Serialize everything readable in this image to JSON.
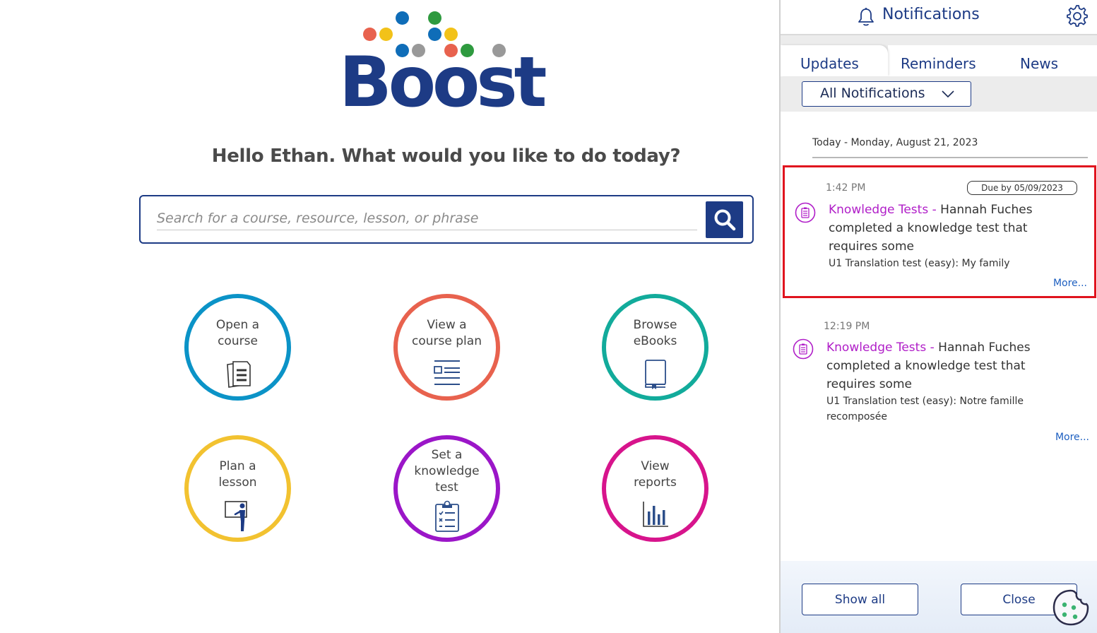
{
  "app": {
    "logo_text": "Boost",
    "logo_dot_colors": [
      "#e8624e",
      "#f2c219",
      "#0f6db8",
      "#2e9a3f",
      "#999999"
    ]
  },
  "main": {
    "greeting": "Hello Ethan. What would you like to do today?",
    "search": {
      "placeholder": "Search for a course, resource, lesson, or phrase",
      "value": ""
    },
    "tiles": [
      {
        "label": "Open a\ncourse",
        "color": "#0b93c7",
        "icon": "documents-icon"
      },
      {
        "label": "View a\ncourse plan",
        "color": "#e8624e",
        "icon": "course-plan-icon"
      },
      {
        "label": "Browse\neBooks",
        "color": "#12ab9b",
        "icon": "ebook-icon"
      },
      {
        "label": "Plan a\nlesson",
        "color": "#f2c230",
        "icon": "teacher-board-icon"
      },
      {
        "label": "Set a\nknowledge\ntest",
        "color": "#9b16c8",
        "icon": "clipboard-checklist-icon"
      },
      {
        "label": "View\nreports",
        "color": "#d7148c",
        "icon": "bar-chart-icon"
      }
    ]
  },
  "notifications": {
    "title": "Notifications",
    "tabs": [
      "Updates",
      "Reminders",
      "News"
    ],
    "active_tab": "Updates",
    "filter": "All Notifications",
    "date_header": "Today - Monday, August 21, 2023",
    "items": [
      {
        "time": "1:42 PM",
        "due": "Due by 05/09/2023",
        "category": "Knowledge Tests",
        "separator": " - ",
        "text": "Hannah Fuches completed a knowledge test that requires some",
        "detail": "U1 Translation test (easy): My family",
        "more": "More..."
      },
      {
        "time": "12:19 PM",
        "category": "Knowledge Tests",
        "separator": " - ",
        "text": "Hannah Fuches completed a knowledge test that requires some",
        "detail": "U1 Translation test (easy): Notre famille recomposée",
        "more": "More..."
      }
    ],
    "footer": {
      "show_all": "Show all",
      "close": "Close"
    }
  }
}
